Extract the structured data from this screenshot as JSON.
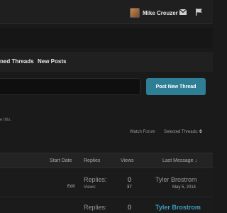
{
  "header": {
    "user_name": "Mike Creuzer",
    "icons": [
      "avatar",
      "mail-icon",
      "flag-icon"
    ]
  },
  "nav": {
    "items": [
      "ned Threads",
      "New Posts"
    ]
  },
  "toolbar": {
    "post_button": "Post New Thread"
  },
  "notice": {
    "text": "e this."
  },
  "forum_controls": {
    "watch": "Watch Forum",
    "selected_label": "Selected Threads:",
    "selected_count": "0"
  },
  "table": {
    "headers": {
      "start_date": "Start Date",
      "replies": "Replies",
      "views": "Views",
      "last_message": "Last Message ↓"
    },
    "rows": [
      {
        "edit": "Edit",
        "replies_label": "Replies:",
        "replies": "0",
        "views_label": "Views:",
        "views": "37",
        "last_poster": "Tyler Brostrom",
        "last_date": "May 5, 2014"
      },
      {
        "replies_label": "Replies:",
        "replies": "0",
        "last_poster": "Tyler Brostrom"
      }
    ]
  },
  "colors": {
    "accent": "#2e7f95",
    "link": "#3a9ec0",
    "background": "#1a1a1a"
  }
}
